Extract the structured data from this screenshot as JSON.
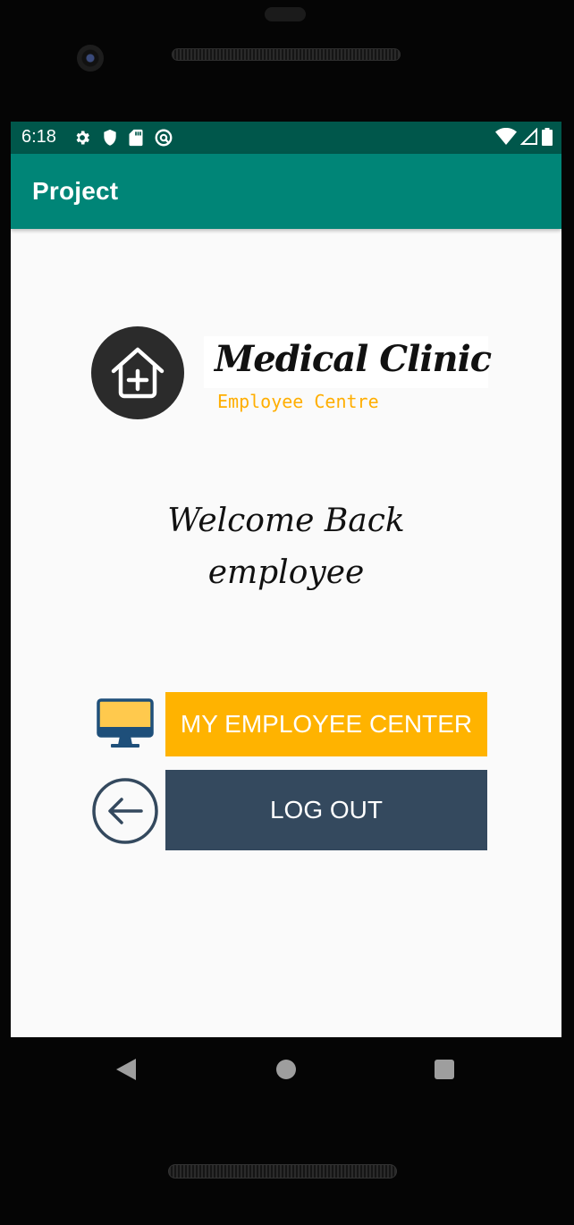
{
  "status_bar": {
    "time": "6:18",
    "icons_left": [
      "gear-icon",
      "shield-icon",
      "sd-card-icon",
      "sync-icon"
    ],
    "icons_right": [
      "wifi-icon",
      "signal-icon",
      "battery-icon"
    ],
    "background": "#00574b"
  },
  "app_bar": {
    "title": "Project",
    "background": "#008577"
  },
  "logo": {
    "icon": "home-plus-icon",
    "brand_name": "Medical Clinic",
    "brand_subtitle": "Employee Centre",
    "subtitle_color": "#ffae00"
  },
  "welcome": {
    "line1": "Welcome Back",
    "line2": "employee"
  },
  "actions": {
    "employee_center": {
      "label": "MY EMPLOYEE CENTER",
      "icon": "monitor-icon",
      "color": "#ffb300"
    },
    "logout": {
      "label": "LOG OUT",
      "icon": "back-arrow-icon",
      "color": "#34495e"
    }
  },
  "nav_bar": {
    "buttons": [
      "nav-back-icon",
      "nav-home-icon",
      "nav-recent-icon"
    ]
  }
}
